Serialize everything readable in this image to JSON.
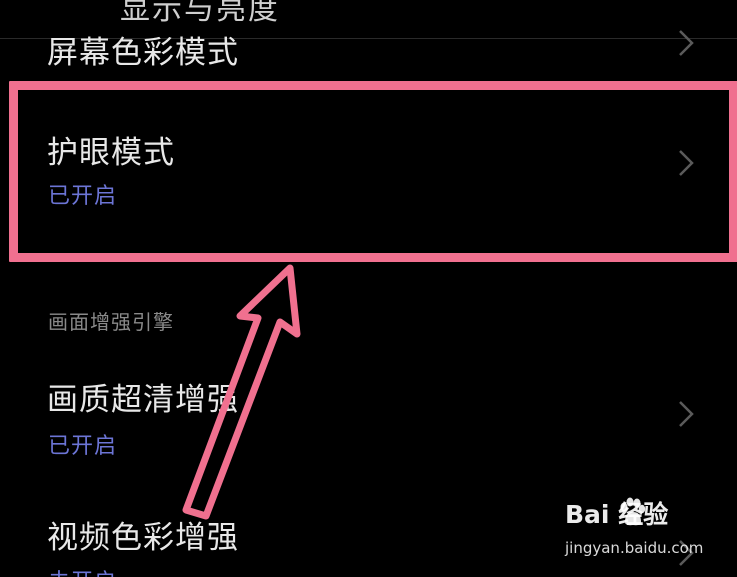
{
  "top_partial_title": "显示与亮度",
  "rows": {
    "screen_color": {
      "title": "屏幕色彩模式"
    },
    "eye_comfort": {
      "title": "护眼模式",
      "status": "已开启"
    },
    "picture_enhance": {
      "title": "画质超清增强",
      "status": "已开启"
    },
    "video_color": {
      "title": "视频色彩增强",
      "status": "未开启"
    }
  },
  "section": {
    "header": "画面增强引擎"
  },
  "watermark": {
    "brand": "Bai  经验",
    "url": "jingyan.baidu.com"
  },
  "colors": {
    "background": "#000000",
    "highlight": "#f0708f",
    "status_text": "#6c75d6"
  },
  "icons": [
    "chevron-right-icon",
    "annotation-arrow-icon",
    "baidu-paw-icon"
  ]
}
